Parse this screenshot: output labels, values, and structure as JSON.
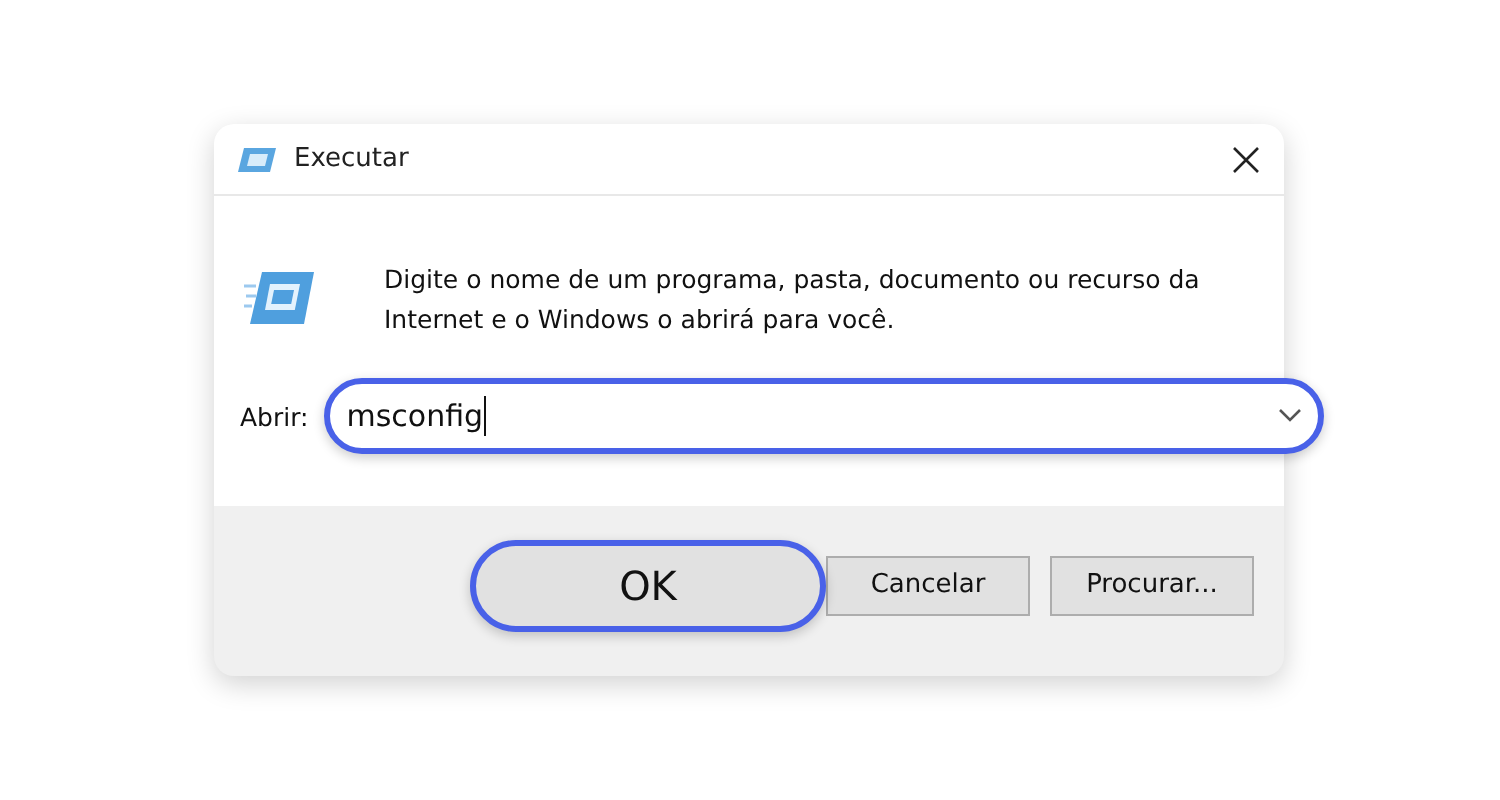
{
  "window": {
    "title": "Executar"
  },
  "description": "Digite o nome de um programa, pasta, documento ou recurso da Internet e o Windows o abrirá para você.",
  "open_field": {
    "label": "Abrir:",
    "value": "msconfig",
    "highlighted": true
  },
  "buttons": [
    {
      "label": "OK",
      "highlighted": true
    },
    {
      "label": "Cancelar",
      "highlighted": false
    },
    {
      "label": "Procurar...",
      "highlighted": false
    }
  ]
}
